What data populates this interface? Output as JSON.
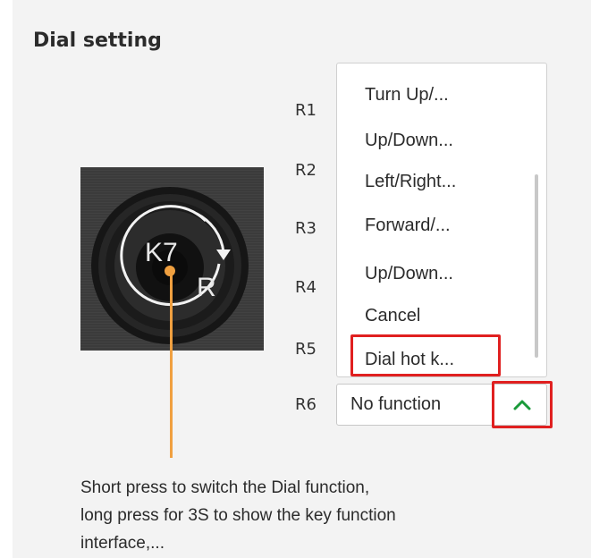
{
  "panel": {
    "title": "Dial setting"
  },
  "dial": {
    "k_label": "K7",
    "r_label": "R"
  },
  "rows": [
    {
      "label": "R1"
    },
    {
      "label": "R2"
    },
    {
      "label": "R3"
    },
    {
      "label": "R4"
    },
    {
      "label": "R5"
    },
    {
      "label": "R6"
    }
  ],
  "dropdown": {
    "items": [
      "Turn Up/...",
      "Up/Down...",
      "Left/Right...",
      "Forward/...",
      "Up/Down...",
      "Cancel",
      "Dial hot k..."
    ]
  },
  "select": {
    "value": "No function"
  },
  "caption": {
    "line1": "Short press to switch the Dial function,",
    "line2": "long press for 3S to show the key function",
    "line3": "interface,..."
  },
  "colors": {
    "highlight": "#e02020",
    "leader": "#f0a040",
    "chevron": "#1a9a3a"
  }
}
